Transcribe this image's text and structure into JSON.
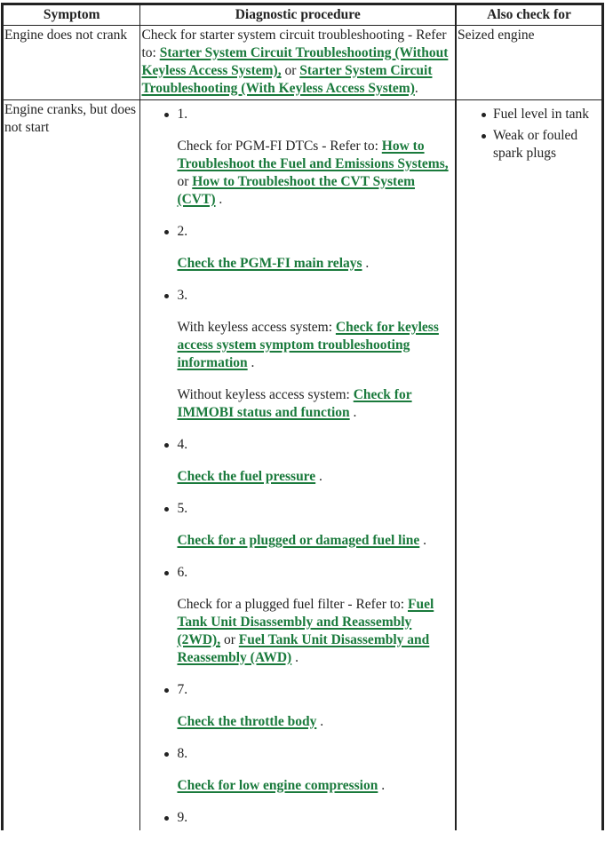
{
  "table": {
    "headers": [
      "Symptom",
      "Diagnostic procedure",
      "Also check for"
    ],
    "rows": [
      {
        "symptom": "Engine does not crank",
        "procedure": {
          "text_before": "Check for starter system circuit troubleshooting - Refer to: ",
          "link1": "Starter System Circuit Troubleshooting (Without Keyless Access System),",
          "text_mid": " or ",
          "link2": "Starter System Circuit Troubleshooting (With Keyless Access System)",
          "text_after": "."
        },
        "also_check": "Seized engine"
      },
      {
        "symptom": "Engine cranks, but does not start",
        "steps": [
          {
            "number": "1.",
            "parts": [
              {
                "text": "Check for PGM-FI DTCs - Refer to: "
              },
              {
                "link": "How to Troubleshoot the Fuel and Emissions Systems,"
              },
              {
                "text": " or "
              },
              {
                "link": "How to Troubleshoot the CVT System (CVT)"
              },
              {
                "text": " ."
              }
            ]
          },
          {
            "number": "2.",
            "parts": [
              {
                "link": "Check the PGM-FI main relays"
              },
              {
                "text": " ."
              }
            ]
          },
          {
            "number": "3.",
            "parts": [
              {
                "text": "With keyless access system: "
              },
              {
                "link": "Check for keyless access system symptom troubleshooting information"
              },
              {
                "text": " ."
              }
            ],
            "parts2": [
              {
                "text": "Without keyless access system: "
              },
              {
                "link": "Check for IMMOBI status and function"
              },
              {
                "text": " ."
              }
            ]
          },
          {
            "number": "4.",
            "parts": [
              {
                "link": "Check the fuel pressure"
              },
              {
                "text": " ."
              }
            ]
          },
          {
            "number": "5.",
            "parts": [
              {
                "link": "Check for a plugged or damaged fuel line"
              },
              {
                "text": " ."
              }
            ]
          },
          {
            "number": "6.",
            "parts": [
              {
                "text": "Check for a plugged fuel filter - Refer to: "
              },
              {
                "link": "Fuel Tank Unit Disassembly and Reassembly (2WD),"
              },
              {
                "text": " or "
              },
              {
                "link": "Fuel Tank Unit Disassembly and Reassembly (AWD)"
              },
              {
                "text": " ."
              }
            ]
          },
          {
            "number": "7.",
            "parts": [
              {
                "link": "Check the throttle body"
              },
              {
                "text": " ."
              }
            ]
          },
          {
            "number": "8.",
            "parts": [
              {
                "link": "Check for low engine compression"
              },
              {
                "text": " ."
              }
            ]
          },
          {
            "number": "9.",
            "parts": []
          }
        ],
        "also_check": [
          "Fuel level in tank",
          "Weak or fouled spark plugs"
        ]
      }
    ]
  },
  "colors": {
    "link": "#1a7a3c",
    "text": "#222222",
    "border": "#222222"
  }
}
